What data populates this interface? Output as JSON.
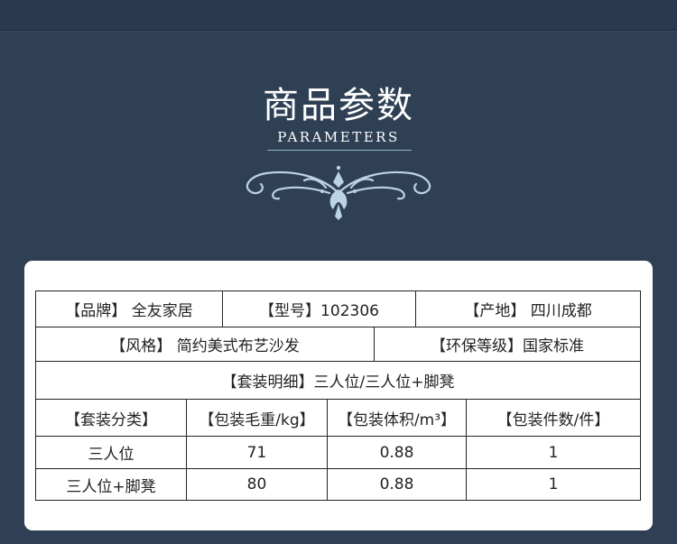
{
  "header": {
    "title": "商品参数",
    "subtitle": "PARAMETERS",
    "ornament_icon": "scroll-flourish-icon"
  },
  "colors": {
    "background": "#2f4055",
    "card": "#ffffff",
    "ornament": "#bcd3e4"
  },
  "params": {
    "row1": {
      "brand": "【品牌】 全友家居",
      "model": "【型号】102306",
      "origin": "【产地】 四川成都"
    },
    "row2": {
      "style": "【风格】 简约美式布艺沙发",
      "eco_grade": "【环保等级】国家标准"
    },
    "row3": {
      "set_detail": "【套装明细】三人位/三人位+脚凳"
    },
    "columns": [
      "【套装分类】",
      "【包装毛重/kg】",
      "【包装体积/m³】",
      "【包装件数/件】"
    ],
    "rows": [
      {
        "category": "三人位",
        "weight": "71",
        "volume": "0.88",
        "pieces": "1"
      },
      {
        "category": "三人位+脚凳",
        "weight": "80",
        "volume": "0.88",
        "pieces": "1"
      }
    ]
  }
}
